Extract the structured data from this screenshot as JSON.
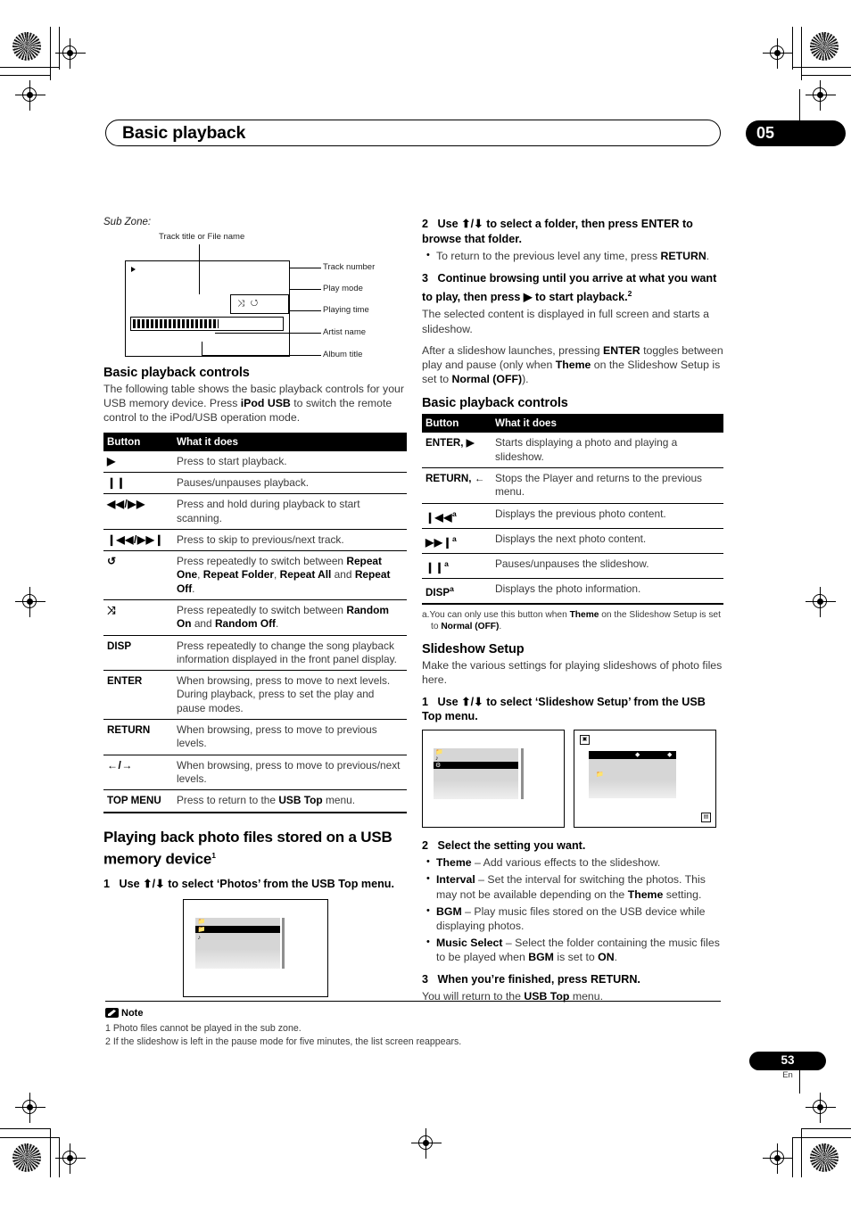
{
  "header": {
    "title": "Basic playback",
    "chapter": "05"
  },
  "left": {
    "subzone_label": "Sub Zone:",
    "diagram": {
      "top_caption": "Track title or File name",
      "callouts": [
        "Track number",
        "Play mode",
        "Playing time",
        "Artist name",
        "Album title"
      ]
    },
    "controls_heading": "Basic playback controls",
    "controls_intro_1": "The following table shows the basic playback controls for your USB memory device. Press ",
    "controls_intro_bold": "iPod USB",
    "controls_intro_2": " to switch the remote control to the iPod/USB operation mode.",
    "table": {
      "col_button": "Button",
      "col_what": "What it does",
      "rows": [
        {
          "button": "▶",
          "glyph": true,
          "text": "Press to start playback."
        },
        {
          "button": "❙❙",
          "glyph": true,
          "text": "Pauses/unpauses playback."
        },
        {
          "button": "◀◀/▶▶",
          "glyph": true,
          "text": "Press and hold during playback to start scanning."
        },
        {
          "button": "❙◀◀/▶▶❙",
          "glyph": true,
          "text": "Press to skip to previous/next track."
        },
        {
          "button": "↺",
          "glyph": true,
          "text_html": "Press repeatedly to switch between <b>Repeat One</b>, <b>Repeat Folder</b>, <b>Repeat All</b> and <b>Repeat Off</b>."
        },
        {
          "button": "⤨",
          "glyph": true,
          "text_html": "Press repeatedly to switch between <b>Random On</b> and <b>Random Off</b>."
        },
        {
          "button": "DISP",
          "glyph": false,
          "text": "Press repeatedly to change the song playback information displayed in the front panel display."
        },
        {
          "button": "ENTER",
          "glyph": false,
          "text": "When browsing, press to move to next levels. During playback, press to set the play and pause modes."
        },
        {
          "button": "RETURN",
          "glyph": false,
          "text": "When browsing, press to move to previous levels."
        },
        {
          "button": "←/→",
          "glyph": true,
          "text": "When browsing, press to move to previous/next levels."
        },
        {
          "button": "TOP MENU",
          "glyph": false,
          "text_html": "Press to return to the <b>USB Top</b> menu."
        }
      ]
    },
    "photo_heading_1": "Playing back photo files stored on a USB",
    "photo_heading_2": "memory device",
    "photo_heading_sup": "1",
    "step1_num": "1",
    "step1_text": "Use ⬆/⬇ to select ‘Photos’ from the USB Top menu."
  },
  "right": {
    "step2_num": "2",
    "step2_text": "Use ⬆/⬇ to select a folder, then press ENTER to browse that folder.",
    "step2_bullet_pre": "To return to the previous level any time, press ",
    "step2_bullet_bold": "RETURN",
    "step2_bullet_post": ".",
    "step3_num": "3",
    "step3_text_a": "Continue browsing until you arrive at what you want to play, then press ▶ to start playback.",
    "step3_sup": "2",
    "step3_body_1": "The selected content is displayed in full screen and starts a slideshow.",
    "step3_body_2_a": "After a slideshow launches, pressing ",
    "step3_body_2_b": "ENTER",
    "step3_body_2_c": " toggles between play and pause (only when ",
    "step3_body_2_d": "Theme",
    "step3_body_2_e": " on the Slideshow Setup is set to ",
    "step3_body_2_f": "Normal (OFF)",
    "step3_body_2_g": ").",
    "controls_heading": "Basic playback controls",
    "table": {
      "col_button": "Button",
      "col_what": "What it does",
      "rows": [
        {
          "button": "ENTER, ▶",
          "text": "Starts displaying a photo and playing a slideshow."
        },
        {
          "button": "RETURN, ←",
          "text": "Stops the Player and returns to the previous menu."
        },
        {
          "button": "❙◀◀",
          "sup": "a",
          "glyph": true,
          "text": "Displays the previous photo content."
        },
        {
          "button": "▶▶❙",
          "sup": "a",
          "glyph": true,
          "text": "Displays the next photo content."
        },
        {
          "button": "❙❙",
          "sup": "a",
          "glyph": true,
          "text": "Pauses/unpauses the slideshow."
        },
        {
          "button": "DISP",
          "sup": "a",
          "glyph": false,
          "text": "Displays the photo information."
        }
      ]
    },
    "table_footnote_a": "a.You can only use this button when ",
    "table_footnote_b": "Theme",
    "table_footnote_c": " on the Slideshow Setup is set to ",
    "table_footnote_d": "Normal (OFF)",
    "table_footnote_e": ".",
    "slideshow_heading": "Slideshow Setup",
    "slideshow_intro": "Make the various settings for playing slideshows of photo files here.",
    "ss_step1_num": "1",
    "ss_step1_text": "Use ⬆/⬇ to select ‘Slideshow Setup’ from the USB Top menu.",
    "ss_step2_num": "2",
    "ss_step2_text": "Select the setting you want.",
    "ss_bullets": [
      {
        "term": "Theme",
        "desc": " – Add various effects to the slideshow."
      },
      {
        "term": "Interval",
        "desc": " – Set the interval for switching the photos. This may not be available depending on the ",
        "term2": "Theme",
        "desc2": " setting."
      },
      {
        "term": "BGM",
        "desc": " – Play music files stored on the USB device while displaying photos."
      },
      {
        "term": "Music Select",
        "desc": " – Select the folder containing the music files to be played when ",
        "term2": "BGM",
        "desc2": " is set to ",
        "term3": "ON",
        "desc3": "."
      }
    ],
    "ss_step3_num": "3",
    "ss_step3_text": "When you’re finished, press RETURN.",
    "ss_step3_body_a": "You will return to the ",
    "ss_step3_body_b": "USB Top",
    "ss_step3_body_c": " menu."
  },
  "footer": {
    "note_label": "Note",
    "note_1": "1 Photo files cannot be played in the sub zone.",
    "note_2": "2 If the slideshow is left in the pause mode for five minutes, the list screen reappears.",
    "page_number": "53",
    "language": "En"
  },
  "colors": {
    "ink": "#000000",
    "body_gray": "#3a3a3a",
    "osd_panel": "#d6d6d6"
  }
}
